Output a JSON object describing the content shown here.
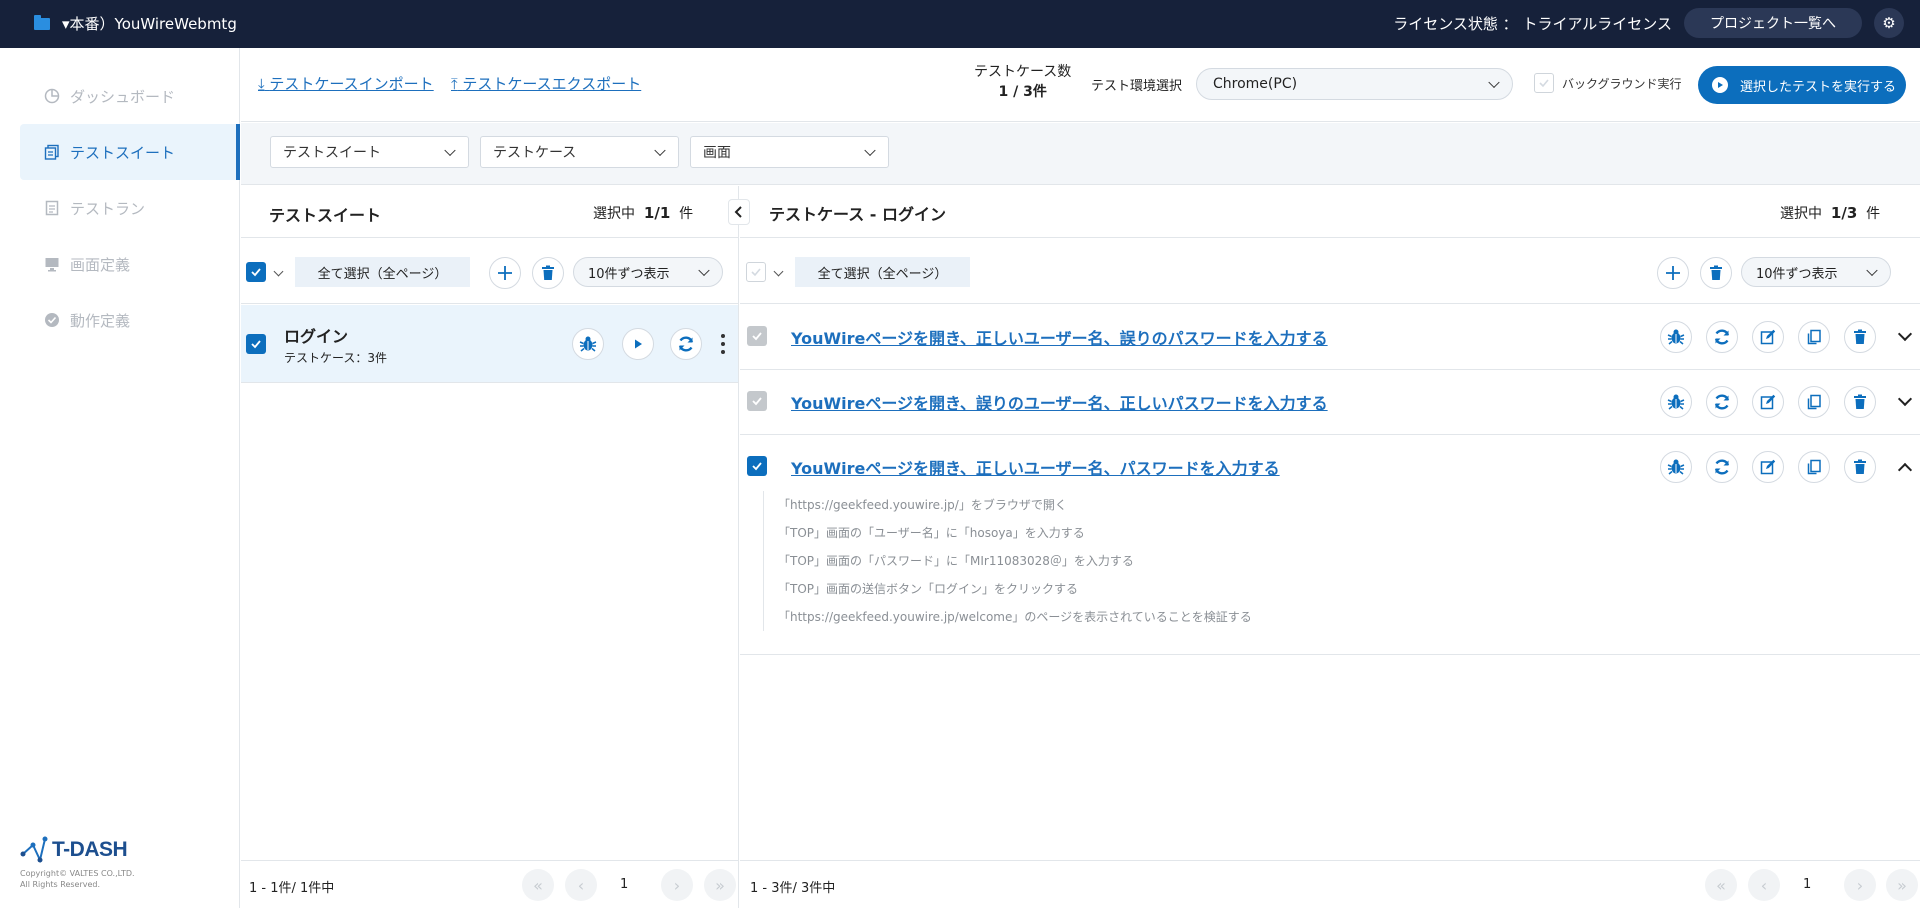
{
  "topbar": {
    "project_name": "▾本番）YouWireWebmtg",
    "license_label": "ライセンス状態 ： トライアルライセンス",
    "project_list_button": "プロジェクト一覧へ"
  },
  "sidebar": {
    "items": [
      {
        "label": "ダッシュボード",
        "icon": "dashboard-icon",
        "active": false
      },
      {
        "label": "テストスイート",
        "icon": "test-suite-icon",
        "active": true
      },
      {
        "label": "テストラン",
        "icon": "test-run-icon",
        "active": false
      },
      {
        "label": "画面定義",
        "icon": "screen-icon",
        "active": false
      },
      {
        "label": "動作定義",
        "icon": "action-icon",
        "active": false
      }
    ],
    "logo_text": "T-DASH",
    "copyright_1": "Copyright© VALTES CO.,LTD.",
    "copyright_2": "All Rights Reserved."
  },
  "toolbar": {
    "import_link": "テストケースインポート",
    "export_link": "テストケースエクスポート",
    "test_case_count_label": "テストケース数",
    "test_case_count_value": "1 / 3件",
    "env_label": "テスト環境選択",
    "env_value": "Chrome(PC)",
    "background_label": "バックグラウンド実行",
    "run_button": "選択したテストを実行する"
  },
  "filters": {
    "suite": "テストスイート",
    "case": "テストケース",
    "screen": "画面"
  },
  "left_panel": {
    "title": "テストスイート",
    "selected_prefix": "選択中",
    "selected_value": "1/1",
    "selected_suffix": "件",
    "select_all": "全て選択（全ページ）",
    "per_page": "10件ずつ表示",
    "suites": [
      {
        "name": "ログイン",
        "sub": "テストケース：3件"
      }
    ],
    "pager_info": "1 - 1件/ 1件中",
    "page": "1"
  },
  "right_panel": {
    "title": "テストケース - ログイン",
    "selected_prefix": "選択中",
    "selected_value": "1/3",
    "selected_suffix": "件",
    "select_all": "全て選択（全ページ）",
    "per_page": "10件ずつ表示",
    "cases": [
      {
        "title": "YouWireページを開き、正しいユーザー名、誤りのパスワードを入力する",
        "checked": false
      },
      {
        "title": "YouWireページを開き、誤りのユーザー名、正しいパスワードを入力する",
        "checked": false
      },
      {
        "title": "YouWireページを開き、正しいユーザー名、パスワードを入力する",
        "checked": true
      }
    ],
    "steps": [
      "「https://geekfeed.youwire.jp/」をブラウザで開く",
      "「TOP」画面の「ユーザー名」に「hosoya」を入力する",
      "「TOP」画面の「パスワード」に「MIr11083028＠」を入力する",
      "「TOP」画面の送信ボタン「ログイン」をクリックする",
      "「https://geekfeed.youwire.jp/welcome」のページを表示されていることを検証する"
    ],
    "pager_info": "1 - 3件/ 3件中",
    "page": "1"
  },
  "colors": {
    "topbar_bg": "#16213a",
    "accent": "#0c6ebd",
    "link": "#1d6fbd"
  }
}
